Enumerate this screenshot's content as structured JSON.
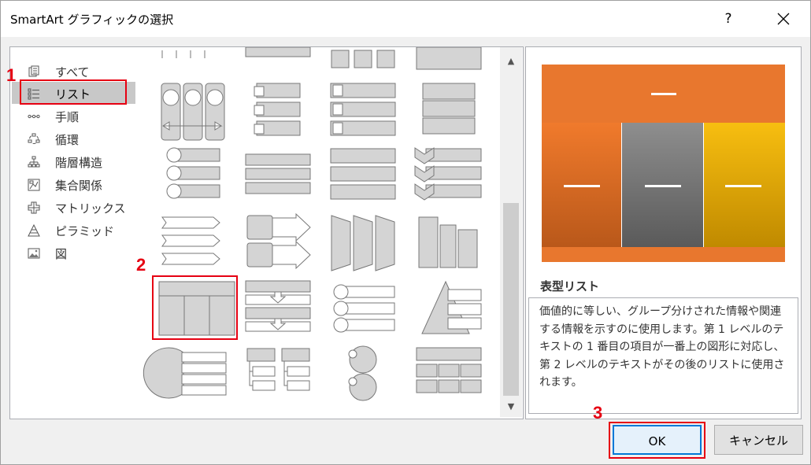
{
  "window": {
    "title": "SmartArt グラフィックの選択",
    "help": "?"
  },
  "categories": [
    {
      "label": "すべて",
      "icon": "all-icon"
    },
    {
      "label": "リスト",
      "icon": "list-icon"
    },
    {
      "label": "手順",
      "icon": "process-icon"
    },
    {
      "label": "循環",
      "icon": "cycle-icon"
    },
    {
      "label": "階層構造",
      "icon": "hierarchy-icon"
    },
    {
      "label": "集合関係",
      "icon": "relationship-icon"
    },
    {
      "label": "マトリックス",
      "icon": "matrix-icon"
    },
    {
      "label": "ピラミッド",
      "icon": "pyramid-icon"
    },
    {
      "label": "図",
      "icon": "picture-icon"
    }
  ],
  "selected_category": "リスト",
  "selected_layout": "表型リスト",
  "preview": {
    "title": "表型リスト",
    "description": "価値的に等しい、グループ分けされた情報や関連する情報を示すのに使用します。第 1 レベルのテキストの 1 番目の項目が一番上の図形に対応し、第 2 レベルのテキストがその後のリストに使用されます。",
    "colors": {
      "top": "#e8772e",
      "left": "#e8772e",
      "middle": "#7f7f7f",
      "right": "#f0b400"
    }
  },
  "buttons": {
    "ok": "OK",
    "cancel": "キャンセル"
  },
  "annotations": [
    "1",
    "2",
    "3"
  ]
}
